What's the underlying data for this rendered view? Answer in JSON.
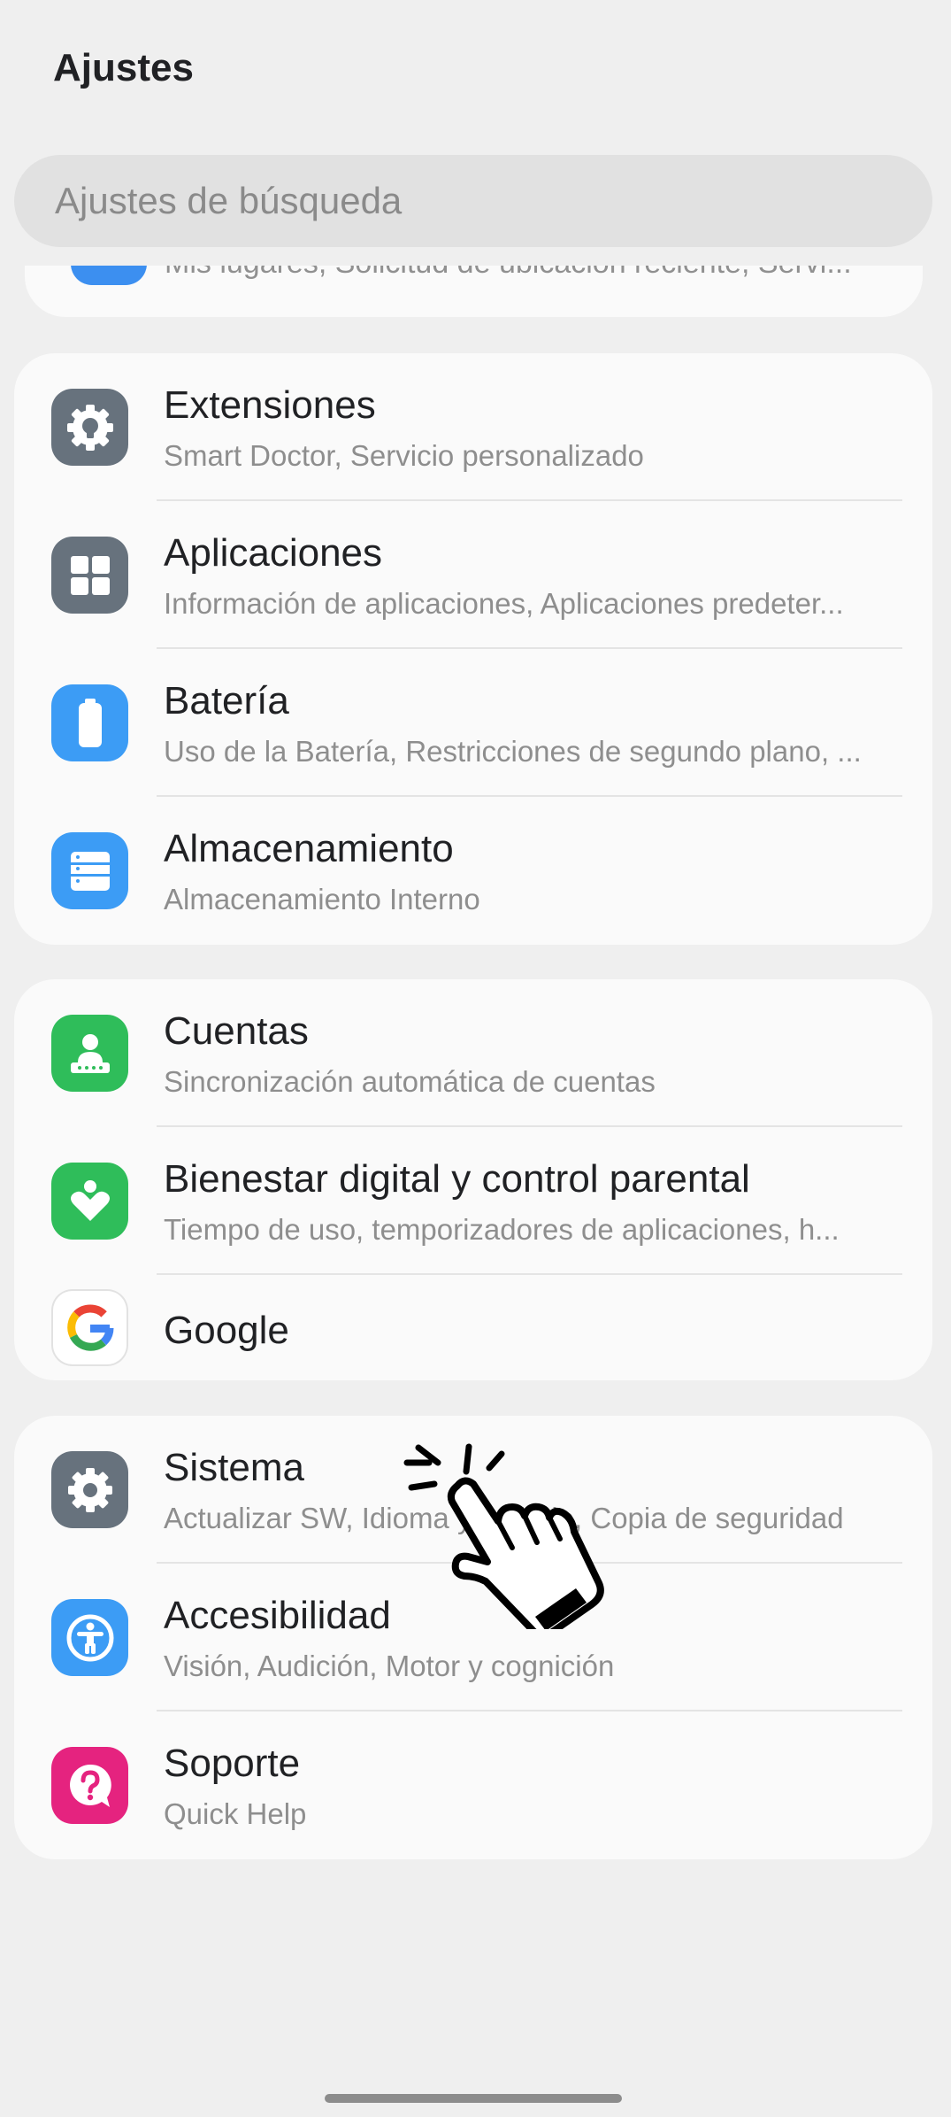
{
  "header": {
    "title": "Ajustes"
  },
  "search": {
    "placeholder": "Ajustes de búsqueda"
  },
  "peek": {
    "subtitle": "Mis lugares, Solicitud de ubicación reciente, Servi..."
  },
  "groups": [
    {
      "items": [
        {
          "title": "Extensiones",
          "subtitle": "Smart Doctor, Servicio personalizado",
          "icon": "extensions-gear-bulb-icon",
          "color": "#67727d"
        },
        {
          "title": "Aplicaciones",
          "subtitle": "Información de aplicaciones, Aplicaciones predeter...",
          "icon": "apps-grid-icon",
          "color": "#67727d"
        },
        {
          "title": "Batería",
          "subtitle": "Uso de la Batería, Restricciones de segundo plano, ...",
          "icon": "battery-icon",
          "color": "#3c9cf5"
        },
        {
          "title": "Almacenamiento",
          "subtitle": "Almacenamiento Interno",
          "icon": "storage-icon",
          "color": "#3c9cf5"
        }
      ]
    },
    {
      "items": [
        {
          "title": "Cuentas",
          "subtitle": "Sincronización automática de cuentas",
          "icon": "accounts-icon",
          "color": "#2fbd5a"
        },
        {
          "title": "Bienestar digital y control parental",
          "subtitle": "Tiempo de uso, temporizadores de aplicaciones, h...",
          "icon": "wellbeing-heart-icon",
          "color": "#2fbd5a"
        },
        {
          "title": "Google",
          "icon": "google-icon"
        }
      ]
    },
    {
      "items": [
        {
          "title": "Sistema",
          "subtitle": "Actualizar SW, Idioma y teclado, Copia de seguridad",
          "icon": "system-gear-icon",
          "color": "#67727d"
        },
        {
          "title": "Accesibilidad",
          "subtitle": "Visión, Audición, Motor y cognición",
          "icon": "accessibility-icon",
          "color": "#3c9cf5"
        },
        {
          "title": "Soporte",
          "subtitle": "Quick Help",
          "icon": "support-question-icon",
          "color": "#e5237f"
        }
      ]
    }
  ]
}
